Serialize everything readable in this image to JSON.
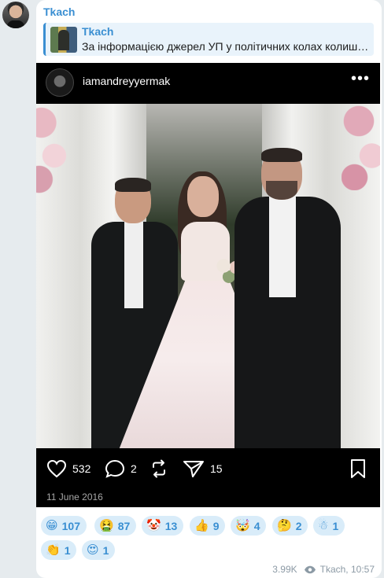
{
  "message": {
    "sender": "Tkach",
    "reply": {
      "name": "Tkach",
      "text": "За інформацією джерел УП у політичних колах колишній"
    },
    "post": {
      "username": "iamandreyyermak",
      "more_icon": "more-icon",
      "likes": "532",
      "comments": "2",
      "shares": "15",
      "date": "11 June 2016"
    },
    "reactions": [
      {
        "emoji": "😁",
        "count": "107"
      },
      {
        "emoji": "🤮",
        "count": "87"
      },
      {
        "emoji": "🤡",
        "count": "13"
      },
      {
        "emoji": "👍",
        "count": "9"
      },
      {
        "emoji": "🤯",
        "count": "4"
      },
      {
        "emoji": "🤔",
        "count": "2"
      },
      {
        "emoji": "☃",
        "count": "1"
      },
      {
        "emoji": "👏",
        "count": "1"
      },
      {
        "emoji": "😍",
        "count": "1"
      }
    ],
    "views": "3.99K",
    "footer": "Tkach, 10:57"
  },
  "colors": {
    "accent": "#3a8fd2",
    "chat_bg": "#e6ebee",
    "reaction_bg": "#d9ecf9"
  }
}
